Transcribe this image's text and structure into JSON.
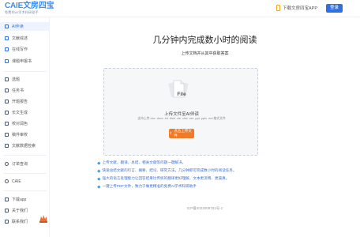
{
  "header": {
    "logo_main": "CAIE文房四宝",
    "logo_sub": "免费的AI学术科研助手",
    "app_link": "下载文房四宝APP",
    "login_label": "登录"
  },
  "sidebar": {
    "items": [
      {
        "label": "AI伴读",
        "icon": "ai-read-icon",
        "active": true
      },
      {
        "label": "文献综述",
        "icon": "review-icon"
      },
      {
        "label": "在线写作",
        "icon": "write-icon"
      },
      {
        "label": "课题申报书",
        "icon": "proposal-icon"
      },
      {
        "label": "选题",
        "icon": "topic-icon"
      },
      {
        "label": "任务书",
        "icon": "task-icon"
      },
      {
        "label": "开题报告",
        "icon": "opening-icon"
      },
      {
        "label": "长文生成",
        "icon": "longtext-icon"
      },
      {
        "label": "校对润色",
        "icon": "proofread-icon"
      },
      {
        "label": "稿件审校",
        "icon": "audit-icon"
      },
      {
        "label": "文献数据检索",
        "icon": "database-icon"
      },
      {
        "label": "订单查询",
        "icon": "order-icon"
      },
      {
        "label": "CAIE",
        "icon": "caie-icon"
      },
      {
        "label": "下载app",
        "icon": "app-icon"
      },
      {
        "label": "关于我们",
        "icon": "about-icon"
      },
      {
        "label": "联系我们",
        "icon": "contact-icon"
      }
    ]
  },
  "main": {
    "title": "几分钟内完成数小时的阅读",
    "subtitle": "上传文档并从其中获取答案",
    "upload": {
      "file_label": "File",
      "hint": "上传文件至AI伴读",
      "formats": "支持上传 doc .docx .txt .html .xls .xlsx .csv .ppt .pptx .md 格式文件",
      "button_label": "点击上传文件"
    },
    "features": [
      "上传文献，翻译、总结、相关文献等问题一键解决。",
      "快速总结文献的引言、摘要、结论、研究方法，几分钟即可完成数小时的阅读任务。",
      "强大的语言处理能力让回答结果比传统的翻译更好理解，文本更流畅、更逼真。",
      "一键上传PDF文件，致力于做更精准的免费AI学术科研助手"
    ],
    "footer": "ICP备2022009761号-1"
  },
  "colors": {
    "brand": "#2f6fe0",
    "accent": "#ee7b2a",
    "feature_text": "#3a6fd8"
  }
}
